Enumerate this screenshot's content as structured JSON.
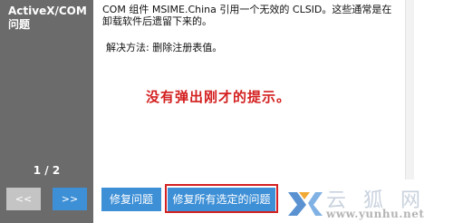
{
  "sidebar": {
    "title": "ActiveX/COM 问题",
    "page_counter": "1 / 2",
    "prev_label": "<<",
    "next_label": ">>"
  },
  "main": {
    "description": "COM 组件 MSIME.China 引用一个无效的 CLSID。这些通常是在卸载软件后遗留下来的。",
    "solution": "解决方法: 删除注册表值。",
    "annotation": "没有弹出刚才的提示。",
    "fix_label": "修复问题",
    "fix_all_label": "修复所有选定的问题"
  },
  "watermark": {
    "brand": "云 狐 网",
    "url": "www.yunhu.net"
  },
  "colors": {
    "sidebar_bg": "#6b6b6b",
    "accent_blue": "#3d8fd6",
    "annotation_red": "#d42020",
    "disabled_gray": "#c4c4c4"
  },
  "icons": {
    "watermark_logo": "yunhu-logo-icon"
  }
}
